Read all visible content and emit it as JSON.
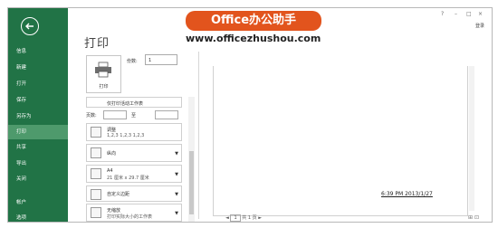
{
  "window": {
    "help": "?",
    "minimize": "–",
    "restore": "□",
    "close": "×",
    "login": "登录"
  },
  "watermark": {
    "brand": "Office办公助手",
    "url": "www.officezhushou.com"
  },
  "sidebar": {
    "items": [
      {
        "label": "信息"
      },
      {
        "label": "新建"
      },
      {
        "label": "打开"
      },
      {
        "label": "保存"
      },
      {
        "label": "另存为"
      },
      {
        "label": "打印"
      },
      {
        "label": "共享"
      },
      {
        "label": "导出"
      },
      {
        "label": "关闭"
      },
      {
        "label": "帐户"
      },
      {
        "label": "选项"
      }
    ]
  },
  "print": {
    "title": "打印",
    "button_label": "打印",
    "copies_label": "份数:",
    "copies_value": "1",
    "pages_label": "页数:",
    "to_label": "至",
    "settings": [
      {
        "line1": "仅打印活动工作表",
        "line2": ""
      },
      {
        "line1": "调整",
        "line2": "1,2,3   1,2,3   1,2,3"
      },
      {
        "line1": "纵向",
        "line2": ""
      },
      {
        "line1": "A4",
        "line2": "21 厘米 x 29.7 厘米"
      },
      {
        "line1": "自定义边距",
        "line2": ""
      },
      {
        "line1": "无缩放",
        "line2": "打印实际大小的工作表"
      }
    ]
  },
  "preview": {
    "content": "6:39 PM  2013/1/27",
    "page_current": "1",
    "page_total": "共 1 页"
  }
}
